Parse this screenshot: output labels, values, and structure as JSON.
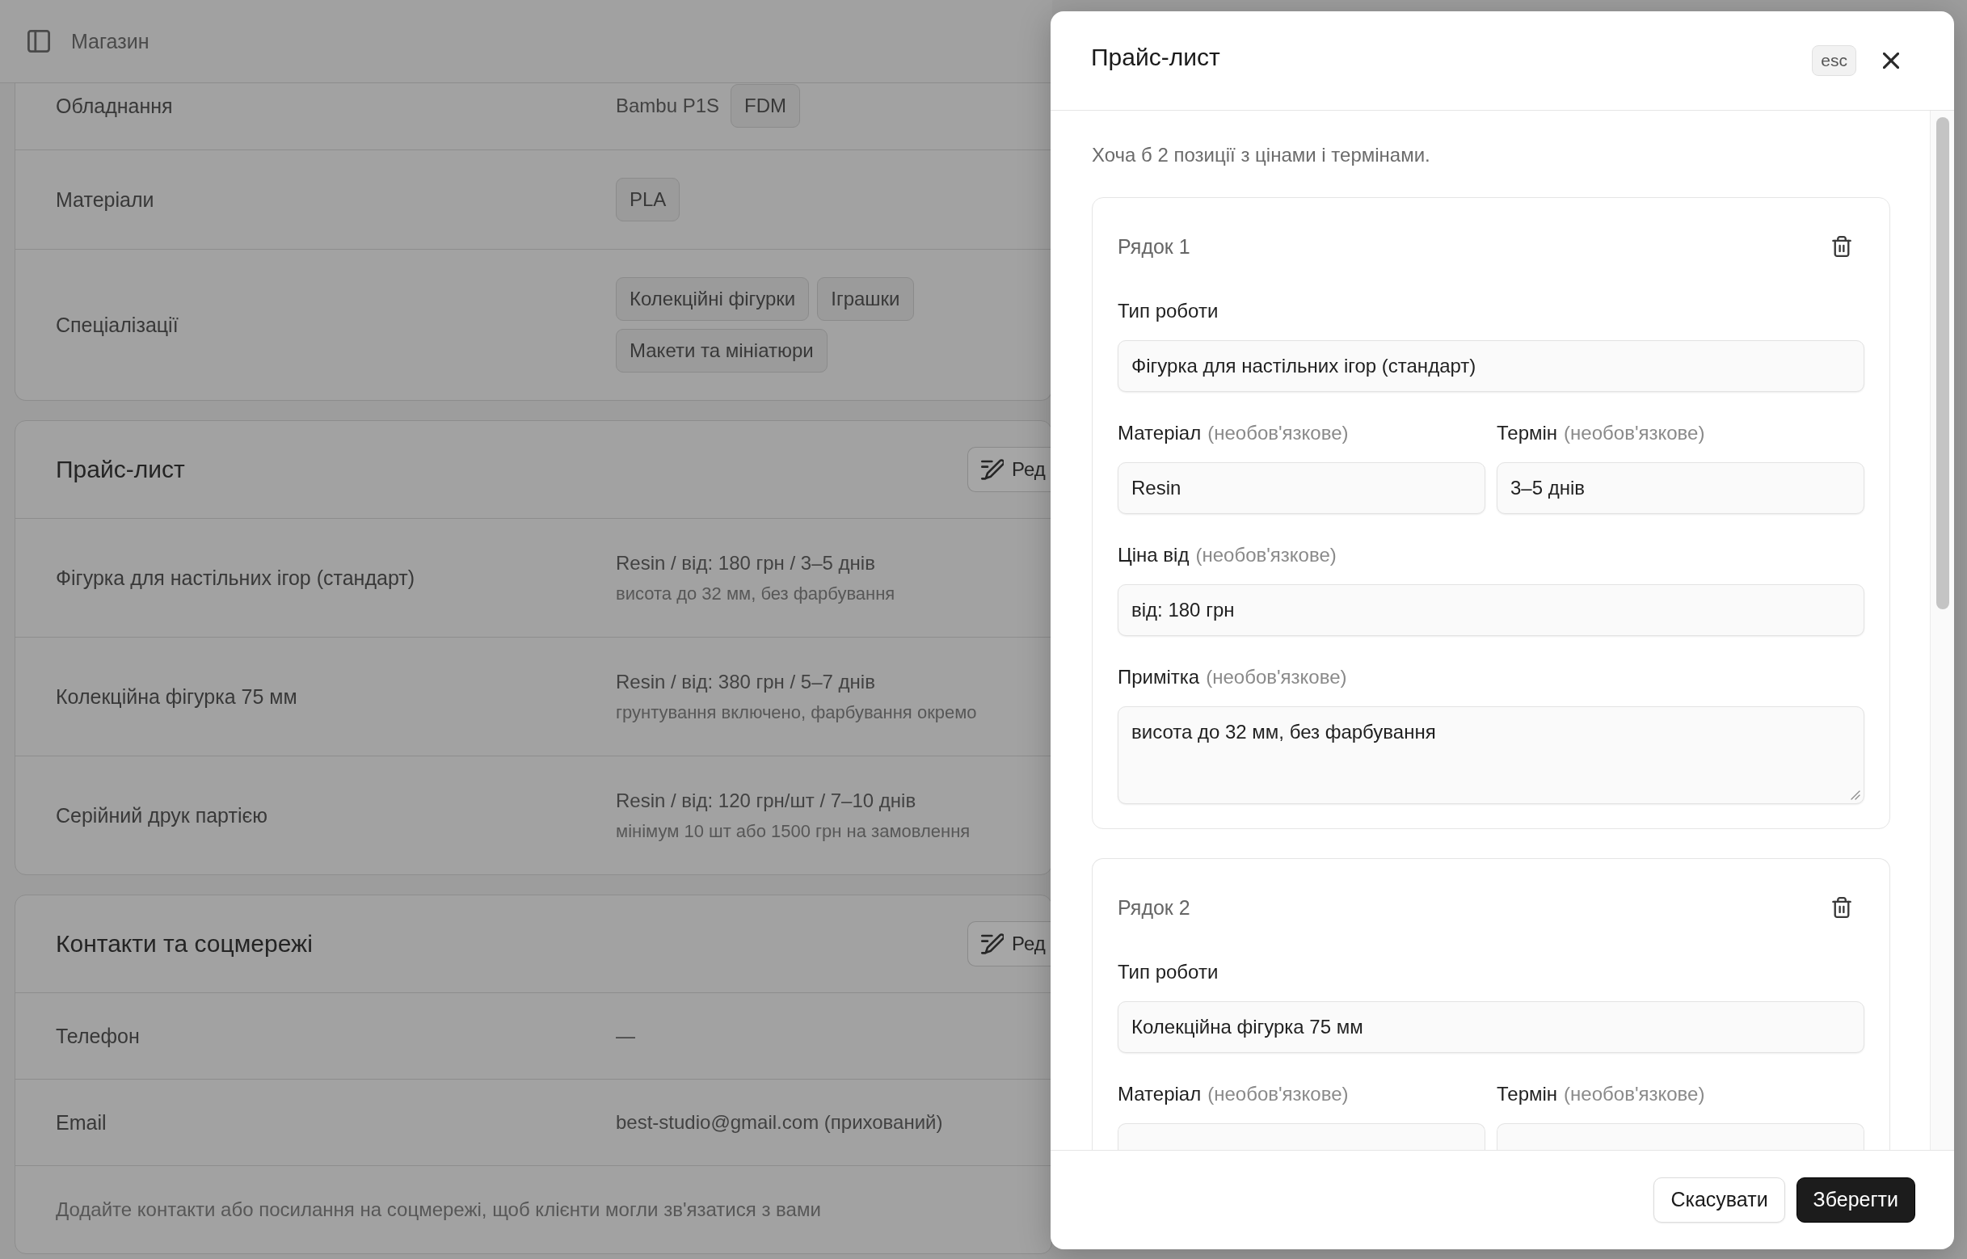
{
  "top_bar": {
    "title": "Магазин"
  },
  "sections": [
    {
      "rows": [
        {
          "label": "Обладнання",
          "value": "Bambu P1S",
          "tags": [
            "FDM"
          ]
        },
        {
          "label": "Матеріали",
          "tags": [
            "PLA"
          ]
        },
        {
          "label": "Спеціалізації",
          "tags": [
            "Колекційні фігурки",
            "Іграшки",
            "Макети та мініатюри"
          ]
        }
      ]
    },
    {
      "title": "Прайс-лист",
      "edit_button": "Ред",
      "rows": [
        {
          "label": "Фігурка для настільних ігор (стандарт)",
          "value": "Resin / від: 180 грн / 3–5 днів",
          "note": "висота до 32 мм, без фарбування"
        },
        {
          "label": "Колекційна фігурка 75 мм",
          "value": "Resin / від: 380 грн / 5–7 днів",
          "note": "грунтування включено, фарбування окремо"
        },
        {
          "label": "Серійний друк партією",
          "value": "Resin / від: 120 грн/шт / 7–10 днів",
          "note": "мінімум 10 шт або 1500 грн на замовлення"
        }
      ]
    },
    {
      "title": "Контакти та соцмережі",
      "edit_button": "Ред",
      "rows": [
        {
          "label": "Телефон",
          "value": "—"
        },
        {
          "label": "Email",
          "value": "best-studio@gmail.com (прихований)"
        }
      ],
      "footer_note": "Додайте контакти або посилання на соцмережі, щоб клієнти могли зв'язатися з вами"
    }
  ],
  "sheet": {
    "title": "Прайс-лист",
    "esc_hint": "esc",
    "intro": "Хоча б 2 позиції з цінами і термінами.",
    "rows": [
      {
        "heading": "Рядок 1",
        "field_rows": [
          [
            {
              "kind": "text",
              "label": "Тип роботи",
              "value": "Фігурка для настільних ігор (стандарт)"
            }
          ],
          [
            {
              "kind": "text",
              "label": "Матеріал",
              "hint": "(необов'язкове)",
              "value": "Resin"
            },
            {
              "kind": "text",
              "label": "Термін",
              "hint": "(необов'язкове)",
              "value": "3–5 днів"
            }
          ],
          [
            {
              "kind": "text",
              "label": "Ціна від",
              "hint": "(необов'язкове)",
              "value": "від: 180 грн"
            }
          ],
          [
            {
              "kind": "textarea",
              "label": "Примітка",
              "hint": "(необов'язкове)",
              "value": "висота до 32 мм, без фарбування"
            }
          ]
        ]
      },
      {
        "heading": "Рядок 2",
        "field_rows": [
          [
            {
              "kind": "text",
              "label": "Тип роботи",
              "value": "Колекційна фігурка 75 мм"
            }
          ],
          [
            {
              "kind": "text",
              "label": "Матеріал",
              "hint": "(необов'язкове)"
            },
            {
              "kind": "text",
              "label": "Термін",
              "hint": "(необов'язкове)"
            }
          ]
        ]
      }
    ],
    "buttons": [
      {
        "kind": "cancel",
        "label": "Скасувати"
      },
      {
        "kind": "save",
        "label": "Зберегти"
      }
    ]
  }
}
